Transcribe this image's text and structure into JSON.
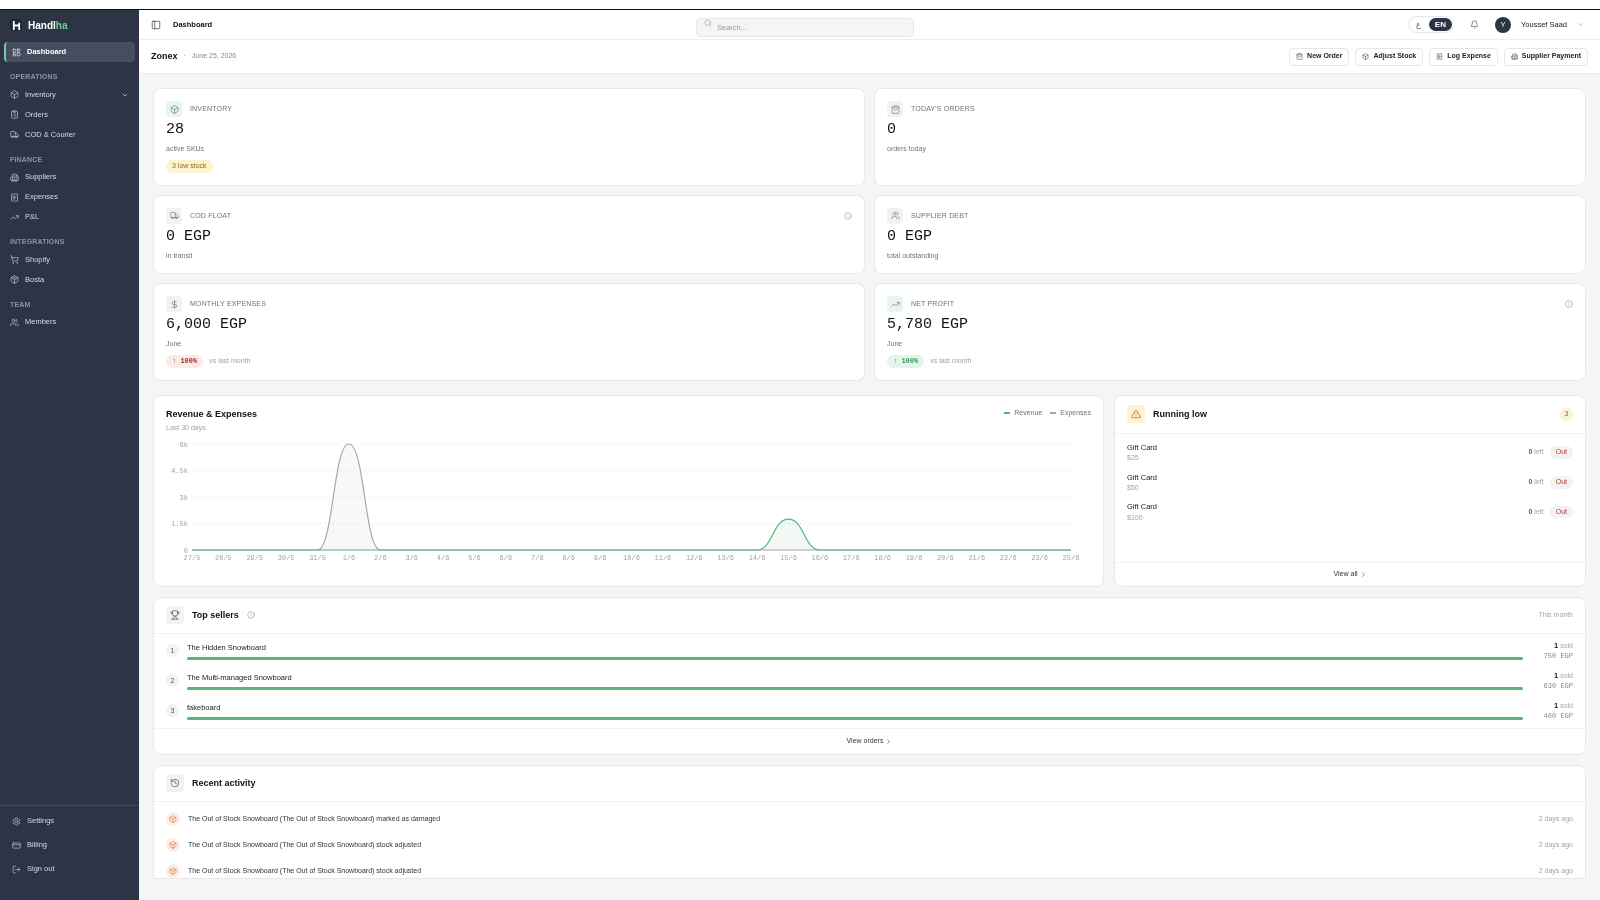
{
  "sidebar": {
    "brand": {
      "text": "Handl",
      "accent": "ha"
    },
    "sections": [
      {
        "items": [
          {
            "label": "Dashboard",
            "selected": true
          }
        ]
      },
      {
        "title": "OPERATIONS",
        "items": [
          {
            "label": "Inventory",
            "selected": false,
            "expanded": false
          },
          {
            "label": "Orders",
            "selected": false
          },
          {
            "label": "COD & Courier",
            "selected": false
          }
        ]
      },
      {
        "title": "FINANCE",
        "items": [
          {
            "label": "Suppliers",
            "selected": false
          },
          {
            "label": "Expenses",
            "selected": false
          },
          {
            "label": "P&L",
            "selected": false
          }
        ]
      },
      {
        "title": "INTEGRATIONS",
        "items": [
          {
            "label": "Shopify",
            "selected": false
          },
          {
            "label": "Bosta",
            "selected": false
          }
        ]
      },
      {
        "title": "TEAM",
        "items": [
          {
            "label": "Members",
            "selected": false
          }
        ]
      }
    ],
    "footer": [
      "Settings",
      "Billing",
      "Sign out"
    ]
  },
  "topbar": {
    "title": "Dashboard",
    "search": {
      "placeholder": "Search..."
    },
    "languages": [
      {
        "label": "ع",
        "selected": false
      },
      {
        "label": "EN",
        "selected": true
      }
    ],
    "user": {
      "initial": "Y",
      "name": "Youssef Saad"
    }
  },
  "header": {
    "store": "Zonex",
    "separator": "·",
    "date": "June 25, 2026",
    "actions": [
      "New Order",
      "Adjust Stock",
      "Log Expense",
      "Supplier Payment"
    ]
  },
  "stats": [
    {
      "label": "INVENTORY",
      "value": "28",
      "sub": "active SKUs",
      "badge": "3 low stock",
      "color": "#e8f5ee"
    },
    {
      "label": "TODAY'S ORDERS",
      "value": "0",
      "sub": "orders today",
      "color": "#f1f2f4"
    },
    {
      "label": "COD FLOAT",
      "value": "0 EGP",
      "sub": "in transit",
      "info": true,
      "color": "#f1f2f4"
    },
    {
      "label": "SUPPLIER DEBT",
      "value": "0 EGP",
      "sub": "total outstanding",
      "color": "#f1f2f4"
    },
    {
      "label": "MONTHLY EXPENSES",
      "value": "6,000 EGP",
      "sub": "June",
      "change": {
        "text": "↑ 100%",
        "color": "#fbeaea",
        "note": "vs last month"
      },
      "color": "#f1f2f4"
    },
    {
      "label": "NET PROFIT",
      "value": "5,780 EGP",
      "sub": "June",
      "change": {
        "text": "↑ 100%",
        "color": "#e5f4eb",
        "note": "vs last month"
      },
      "info": true,
      "color": "#e8f5ee"
    }
  ],
  "revenue_chart": {
    "title": "Revenue & Expenses",
    "subtitle": "Last 30 days",
    "chart_data": {
      "type": "area",
      "grid": true,
      "categories": [
        "27/5",
        "28/5",
        "29/5",
        "30/5",
        "31/5",
        "1/6",
        "2/6",
        "3/6",
        "4/6",
        "5/6",
        "6/6",
        "7/6",
        "8/6",
        "9/6",
        "10/6",
        "11/6",
        "12/6",
        "13/6",
        "14/6",
        "15/6",
        "16/6",
        "17/6",
        "18/6",
        "19/6",
        "20/6",
        "21/6",
        "22/6",
        "23/6",
        "25/6"
      ],
      "series": [
        {
          "name": "Revenue",
          "color": "#5bb37f",
          "values": [
            0,
            0,
            0,
            0,
            0,
            0,
            0,
            0,
            0,
            0,
            0,
            0,
            0,
            0,
            0,
            0,
            0,
            0,
            0,
            1750,
            0,
            0,
            0,
            0,
            0,
            0,
            0,
            0,
            0
          ]
        },
        {
          "name": "Expenses",
          "color": "#a8a8a8",
          "values": [
            0,
            0,
            0,
            0,
            0,
            6000,
            0,
            0,
            0,
            0,
            0,
            0,
            0,
            0,
            0,
            0,
            0,
            0,
            0,
            0,
            0,
            0,
            0,
            0,
            0,
            0,
            0,
            0,
            0
          ]
        }
      ],
      "ylim": [
        0,
        6000
      ],
      "yticks": [
        {
          "value": 0,
          "label": "0"
        },
        {
          "value": 1500,
          "label": "1.5k"
        },
        {
          "value": 3000,
          "label": "3k"
        },
        {
          "value": 4500,
          "label": "4.5k"
        },
        {
          "value": 6000,
          "label": "6k"
        }
      ]
    }
  },
  "running_low": {
    "title": "Running low",
    "count": "3",
    "items": [
      {
        "name": "Gift Card",
        "price": "$25",
        "qty": "0",
        "unit": "left",
        "status": "Out"
      },
      {
        "name": "Gift Card",
        "price": "$50",
        "qty": "0",
        "unit": "left",
        "status": "Out"
      },
      {
        "name": "Gift Card",
        "price": "$100",
        "qty": "0",
        "unit": "left",
        "status": "Out"
      }
    ],
    "link": "View all"
  },
  "top_sellers": {
    "title": "Top sellers",
    "period": "This month",
    "rows": [
      {
        "rank": "1",
        "name": "The Hidden Snowboard",
        "level": 1,
        "qty": "1",
        "unit": "sold",
        "revenue": "750 EGP"
      },
      {
        "rank": "2",
        "name": "The Multi-managed Snowboard",
        "level": 1,
        "qty": "1",
        "unit": "sold",
        "revenue": "630 EGP"
      },
      {
        "rank": "3",
        "name": "fakeboard",
        "level": 1,
        "qty": "1",
        "unit": "sold",
        "revenue": "400 EGP"
      }
    ],
    "link": "View orders"
  },
  "recent_activity": {
    "title": "Recent activity",
    "items": [
      {
        "text": "The Out of Stock Snowboard (The Out of Stock Snowboard) marked as damaged",
        "time": "2 days ago"
      },
      {
        "text": "The Out of Stock Snowboard (The Out of Stock Snowboard) stock adjusted",
        "time": "2 days ago"
      },
      {
        "text": "The Out of Stock Snowboard (The Out of Stock Snowboard) stock adjusted",
        "time": "2 days ago"
      }
    ]
  }
}
